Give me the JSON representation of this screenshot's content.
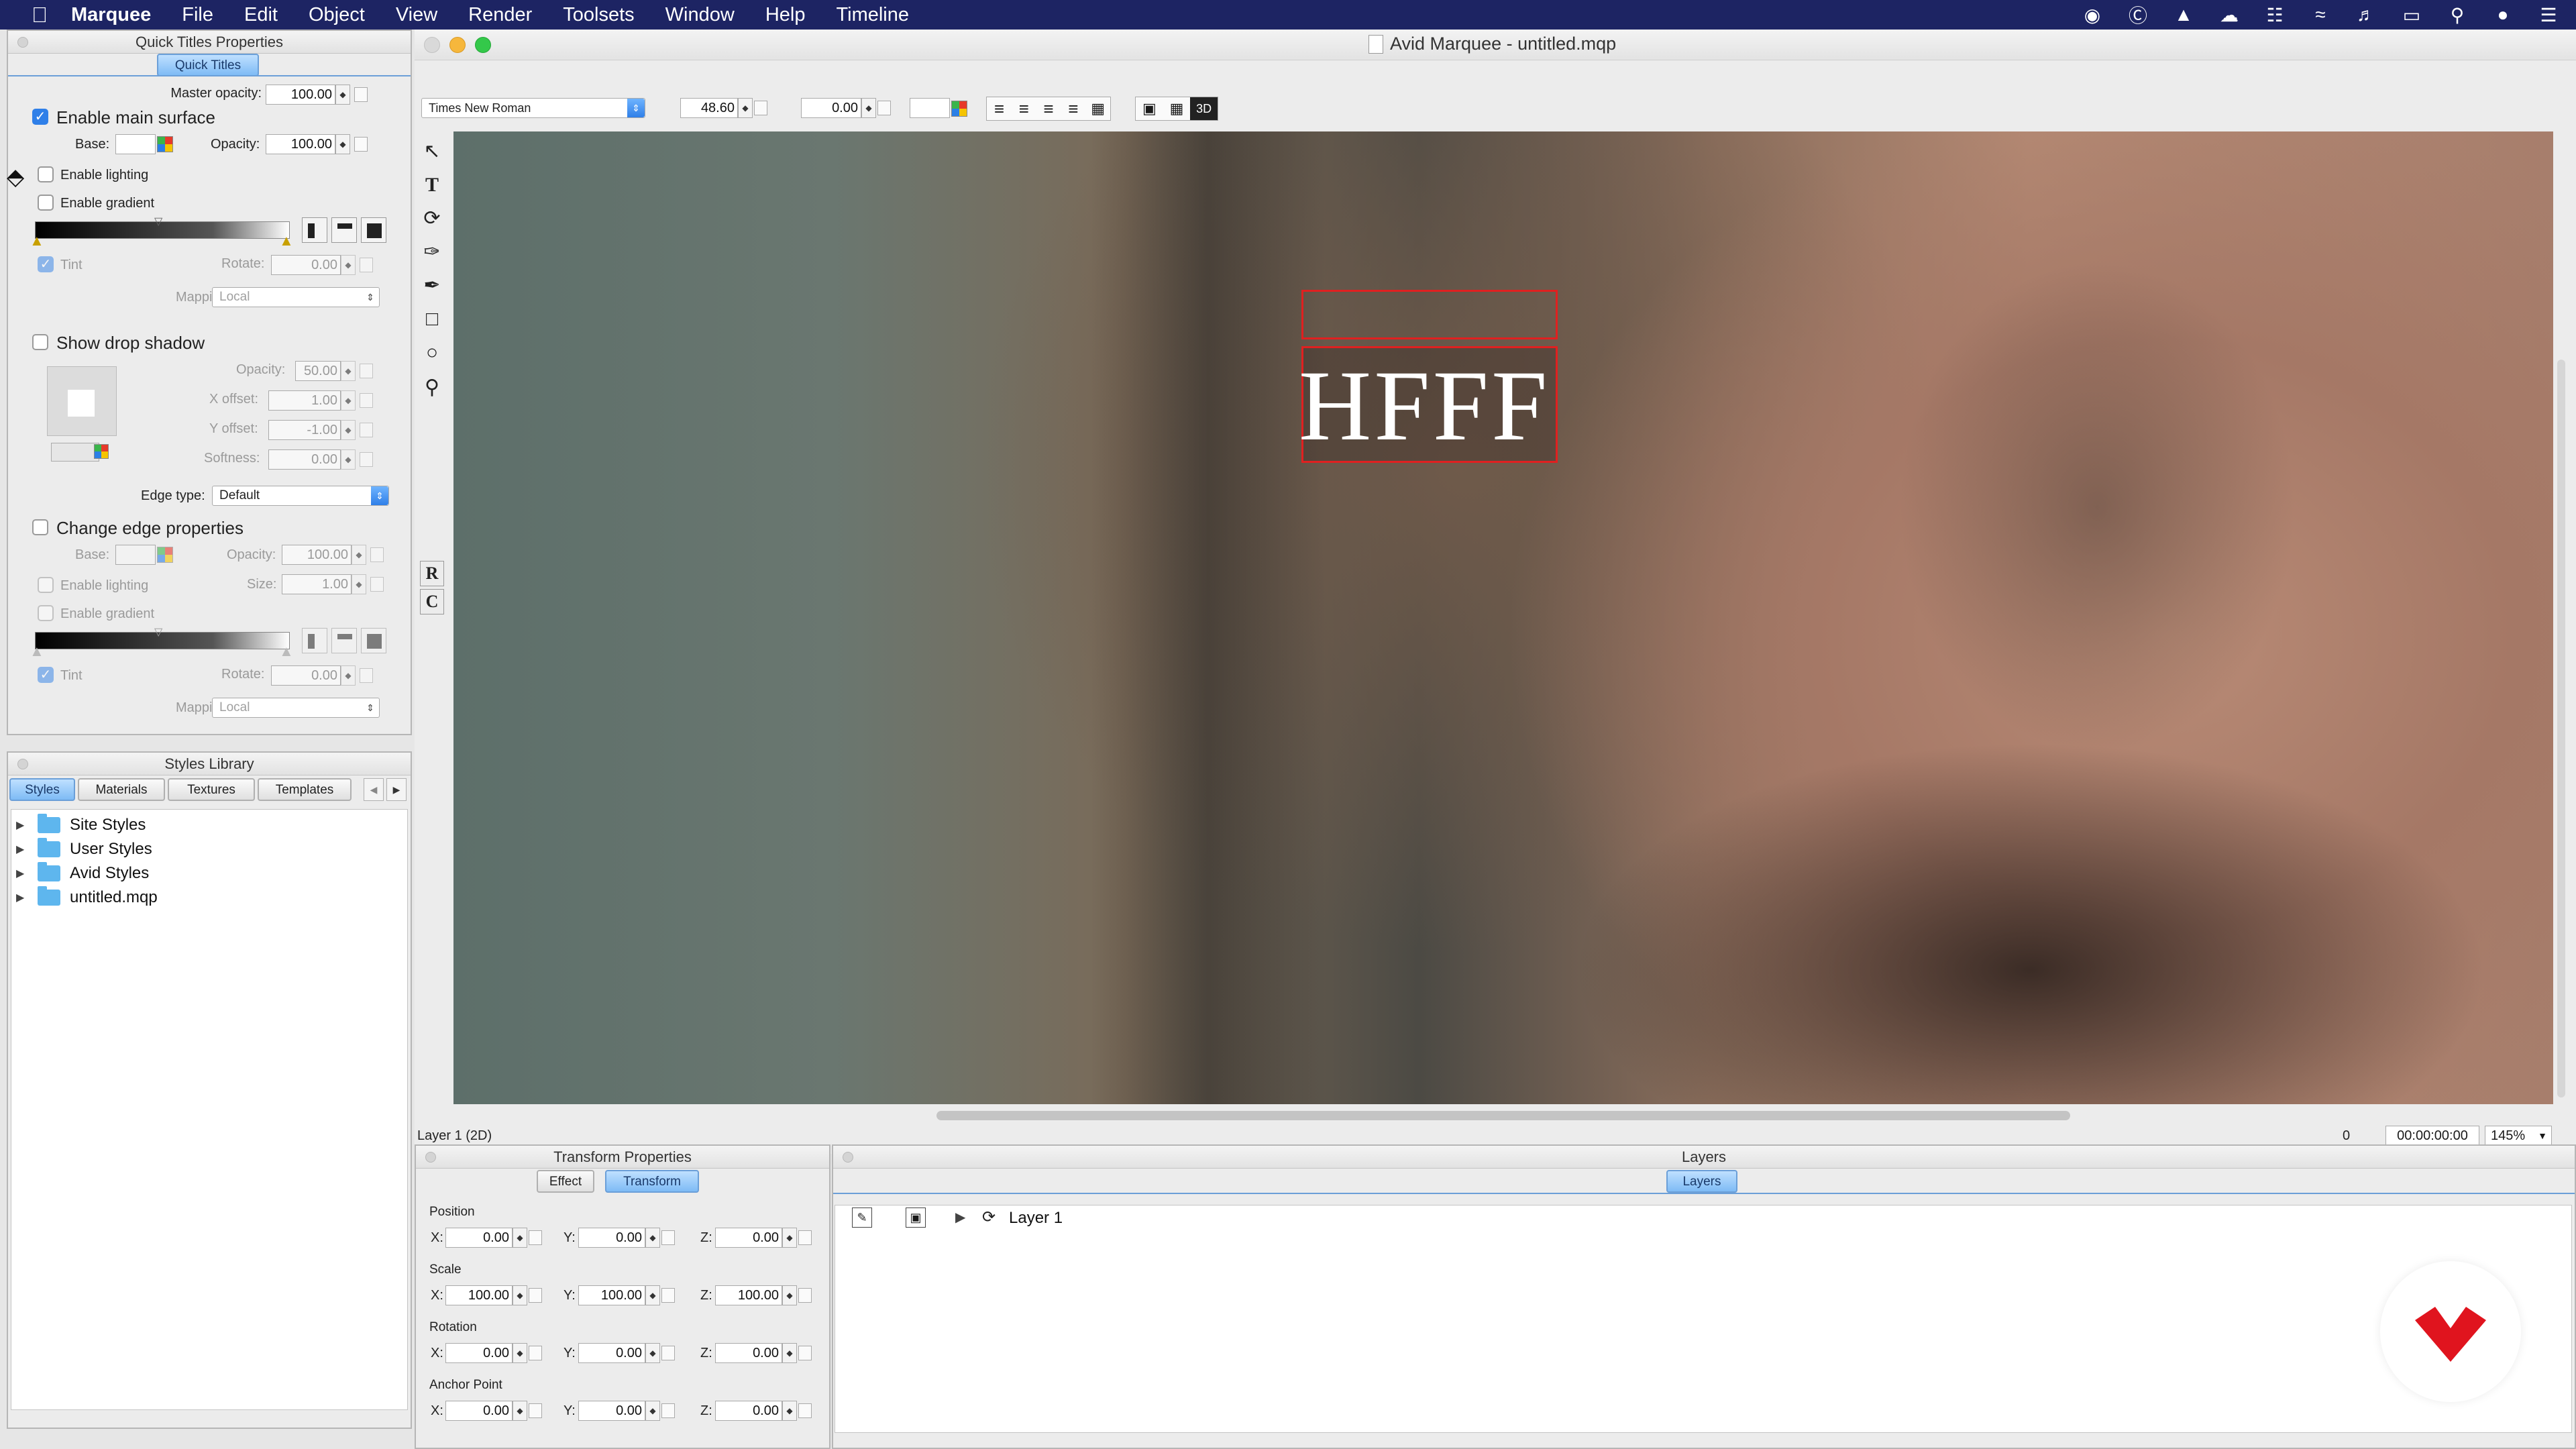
{
  "menubar": {
    "app": "Marquee",
    "items": [
      "File",
      "Edit",
      "Object",
      "View",
      "Render",
      "Toolsets",
      "Window",
      "Help",
      "Timeline"
    ]
  },
  "quick_titles": {
    "panel_title": "Quick Titles Properties",
    "tab": "Quick Titles",
    "master_opacity_label": "Master opacity:",
    "master_opacity": "100.00",
    "enable_main_surface": "Enable main surface",
    "base_label": "Base:",
    "opacity_label": "Opacity:",
    "opacity": "100.00",
    "enable_lighting": "Enable lighting",
    "enable_gradient": "Enable gradient",
    "tint": "Tint",
    "rotate_label": "Rotate:",
    "rotate": "0.00",
    "mapping_label": "Mapping:",
    "mapping": "Local",
    "show_drop_shadow": "Show drop shadow",
    "shadow_opacity": "50.00",
    "x_offset_label": "X offset:",
    "x_offset": "1.00",
    "y_offset_label": "Y offset:",
    "y_offset": "-1.00",
    "softness_label": "Softness:",
    "softness": "0.00",
    "edge_type_label": "Edge type:",
    "edge_type": "Default",
    "change_edge": "Change edge properties",
    "edge_opacity": "100.00",
    "size_label": "Size:",
    "size": "1.00",
    "edge_rotate": "0.00"
  },
  "styles_library": {
    "title": "Styles Library",
    "tabs": [
      "Styles",
      "Materials",
      "Textures",
      "Templates"
    ],
    "items": [
      "Site Styles",
      "User Styles",
      "Avid Styles",
      "untitled.mqp"
    ]
  },
  "window": {
    "title": "Avid Marquee - untitled.mqp"
  },
  "toolbar": {
    "font": "Times New Roman",
    "font_size": "48.60",
    "kerning": "0.00"
  },
  "canvas": {
    "title_text": "HFFF",
    "tool_r": "R",
    "tool_c": "C"
  },
  "status": {
    "layer": "Layer 1 (2D)",
    "frame": "0",
    "timecode": "00:00:00:00",
    "zoom": "145%"
  },
  "transform": {
    "panel_title": "Transform Properties",
    "tabs": [
      "Effect",
      "Transform"
    ],
    "position_label": "Position",
    "scale_label": "Scale",
    "rotation_label": "Rotation",
    "anchor_label": "Anchor Point",
    "x": "X:",
    "y": "Y:",
    "z": "Z:",
    "position": [
      "0.00",
      "0.00",
      "0.00"
    ],
    "scale": [
      "100.00",
      "100.00",
      "100.00"
    ],
    "rotation": [
      "0.00",
      "0.00",
      "0.00"
    ],
    "anchor": [
      "0.00",
      "0.00",
      "0.00"
    ]
  },
  "layers": {
    "panel_title": "Layers",
    "tab": "Layers",
    "layer_name": "Layer 1"
  },
  "colors": {
    "menubar": "#1d2463",
    "selection": "#e02020",
    "logo": "#e0141e",
    "accent": "#2f7fe8"
  }
}
